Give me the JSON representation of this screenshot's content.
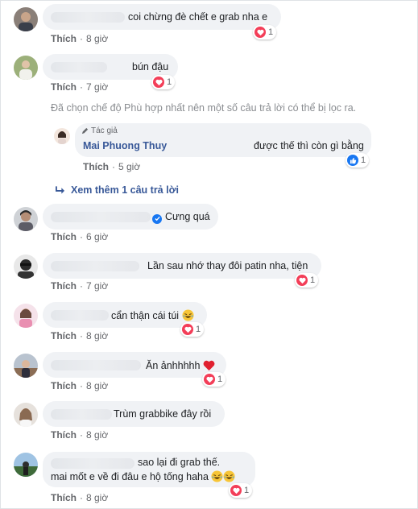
{
  "actions": {
    "like_label": "Thích",
    "separator": "·"
  },
  "comments": [
    {
      "text": "coi chừng đè chết e grab nha e",
      "time": "8 giờ",
      "reaction_count": "1"
    },
    {
      "text": "bún đậu",
      "time": "7 giờ",
      "reaction_count": "1"
    },
    {
      "text": "Cưng quá",
      "time": "6 giờ"
    },
    {
      "text": "Lần sau nhớ thay đôi patin nha, tiện",
      "time": "7 giờ",
      "reaction_count": "1"
    },
    {
      "text": "cẩn thận cái túi",
      "time": "8 giờ",
      "reaction_count": "1"
    },
    {
      "text": "Ăn ảnhhhhh",
      "time": "8 giờ",
      "reaction_count": "1"
    },
    {
      "text": "Trùm grabbike đây rồi",
      "time": "8 giờ"
    },
    {
      "text_line1": "sao lại đi grab thế.",
      "text_line2": "mai mốt e về đi đâu e hộ tống haha",
      "time": "8 giờ",
      "reaction_count": "1"
    }
  ],
  "filter_notice": "Đã chọn chế độ Phù hợp nhất nên một số câu trả lời có thể bị lọc ra.",
  "reply": {
    "author_tag": "Tác giả",
    "author_name": "Mai Phuong Thuy",
    "text": "được thế thì còn gì bằng",
    "time": "5 giờ",
    "reaction_count": "1"
  },
  "view_more": "Xem thêm 1 câu trả lời",
  "icons": {
    "heart_reaction": "heart-icon",
    "like_reaction": "thumbs-up-icon",
    "reply_arrow": "reply-arrow-icon",
    "verified": "verified-badge-icon",
    "author": "pencil-icon"
  },
  "colors": {
    "heart": "#f33e58",
    "like": "#1877f2",
    "link": "#385898",
    "bubble": "#f0f2f5"
  }
}
